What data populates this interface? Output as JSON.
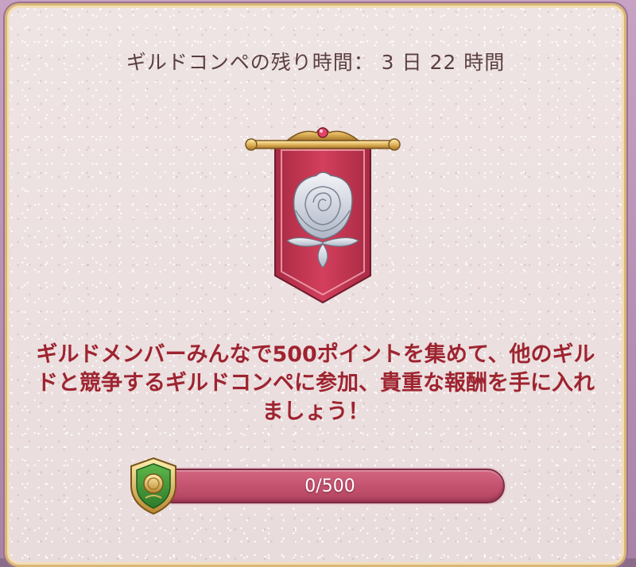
{
  "dialog": {
    "timer_text": "ギルドコンペの残り時間： 3 日 22 時間",
    "emblem": "rose-banner-icon",
    "description": "ギルドメンバーみんなで500ポイントを集めて、他のギルドと競争するギルドコンペに参加、貴重な報酬を手に入れましょう！",
    "progress": {
      "label": "0/500",
      "current": 0,
      "max": 500,
      "fraction": 0,
      "icon": "shield-coin-icon"
    }
  },
  "colors": {
    "description_text": "#9e2430",
    "bar": "#c2516d",
    "banner": "#c8344f",
    "frame_gold": "#d9b678"
  }
}
